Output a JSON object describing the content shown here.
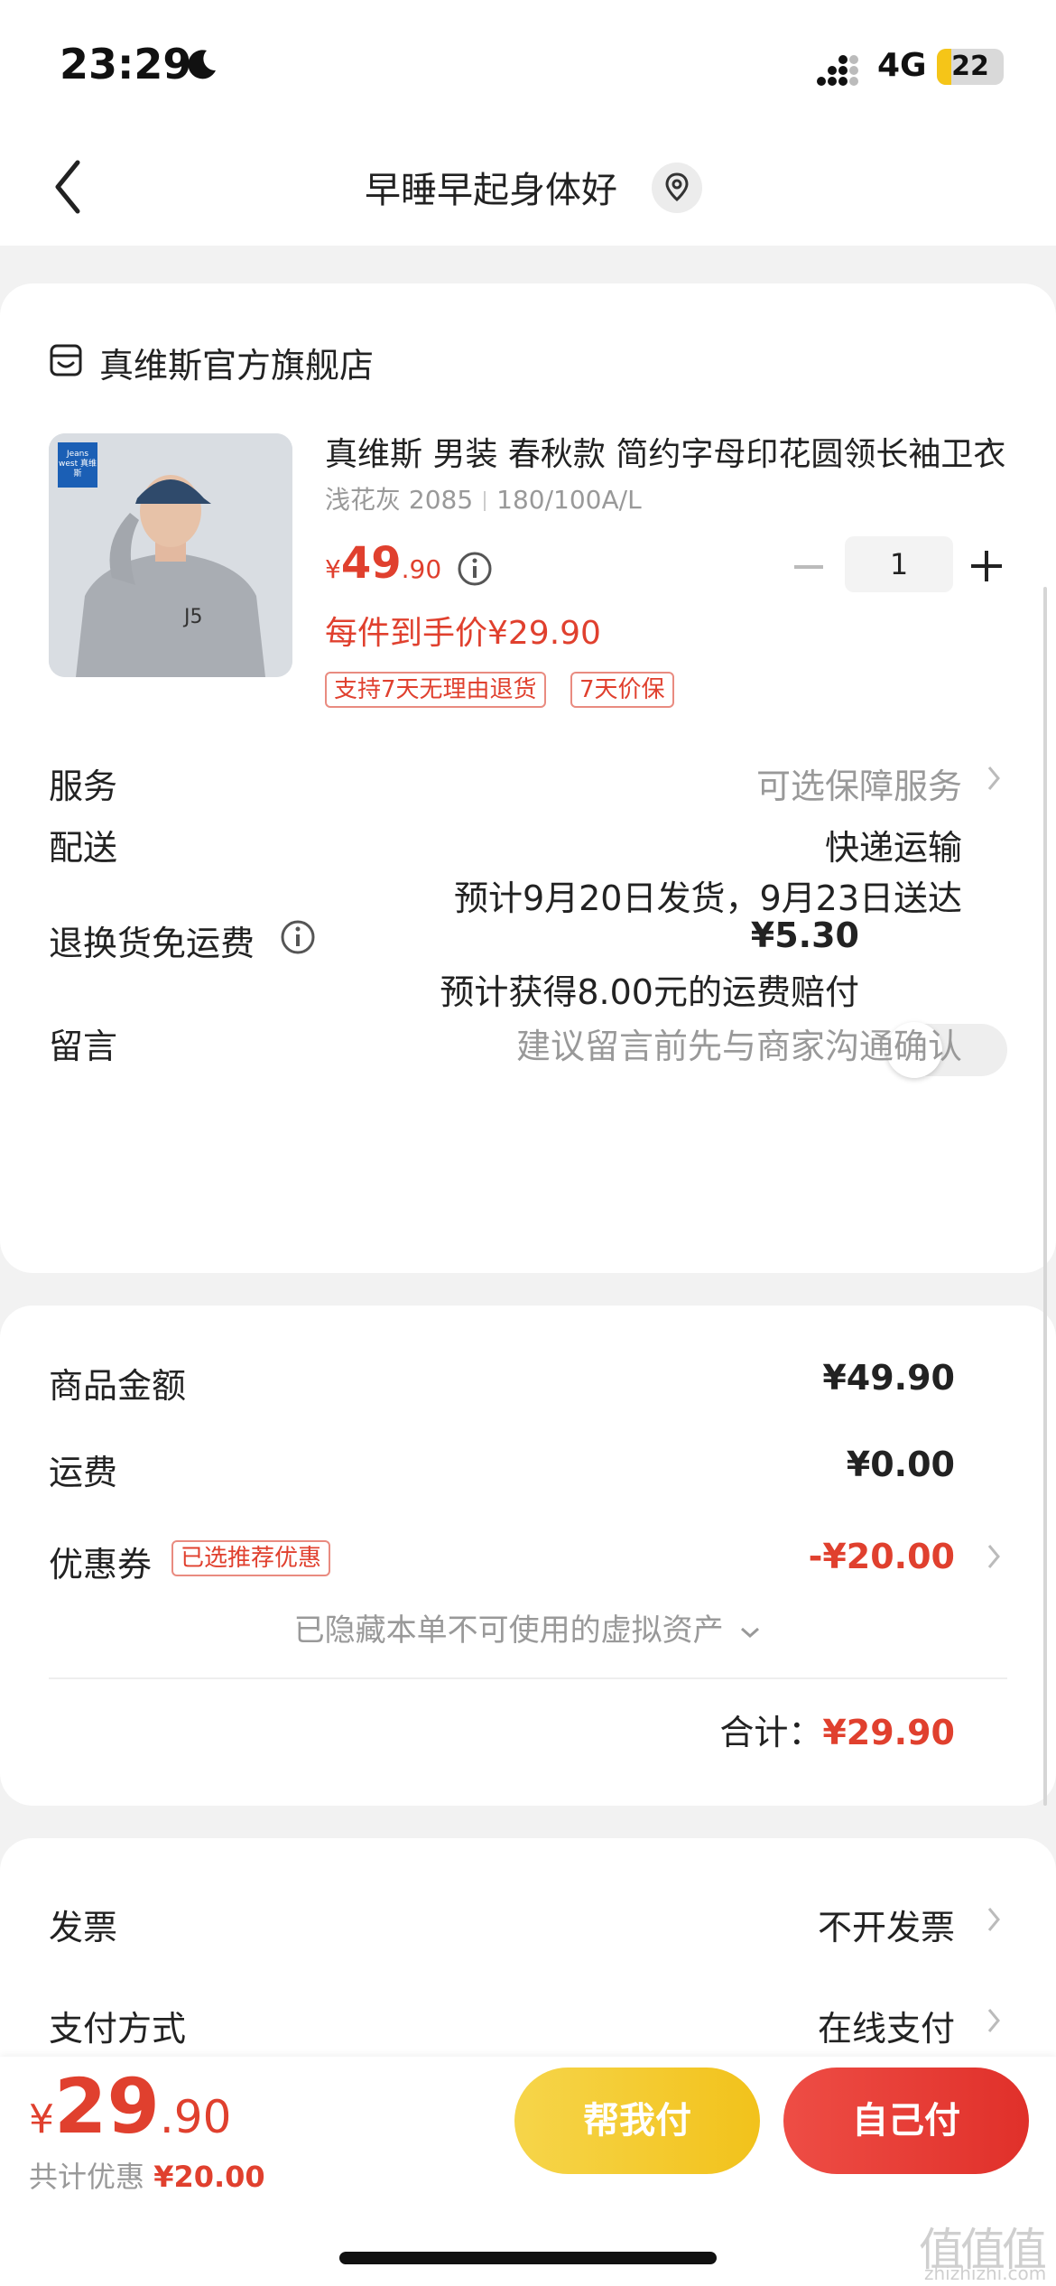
{
  "status_bar": {
    "time": "23:29",
    "network": "4G",
    "battery": "22",
    "battery_level": 0.22
  },
  "nav": {
    "title": "早睡早起身体好"
  },
  "order": {
    "shop_name": "真维斯官方旗舰店",
    "product": {
      "thumbnail_logo": "Jeans west 真维斯",
      "title": "真维斯 男装 春秋款 简约字母印花圆领长袖卫衣",
      "color": "浅花灰 2085",
      "size": "180/100A/L",
      "price_currency": "¥",
      "price_int": "49",
      "price_dec": ".90",
      "quantity": "1",
      "final_price": "每件到手价¥29.90",
      "tags": [
        "支持7天无理由退货",
        "7天价保"
      ]
    },
    "service": {
      "label": "服务",
      "value": "可选保障服务"
    },
    "delivery": {
      "label": "配送",
      "method": "快递运输",
      "eta": "预计9月20日发货，9月23日送达"
    },
    "return_shipping": {
      "label": "退换货免运费",
      "price": "¥5.30",
      "desc": "预计获得8.00元的运费赔付",
      "enabled": false
    },
    "message": {
      "label": "留言",
      "placeholder": "建议留言前先与商家沟通确认"
    }
  },
  "summary": {
    "goods_label": "商品金额",
    "goods_value": "¥49.90",
    "shipping_label": "运费",
    "shipping_value": "¥0.00",
    "coupon_label": "优惠券",
    "coupon_badge": "已选推荐优惠",
    "coupon_value": "-¥20.00",
    "hidden_assets": "已隐藏本单不可使用的虚拟资产",
    "total_label": "合计：",
    "total_value": "¥29.90"
  },
  "payment": {
    "invoice_label": "发票",
    "invoice_value": "不开发票",
    "method_label": "支付方式",
    "method_value": "在线支付"
  },
  "bottom_bar": {
    "currency": "¥",
    "price_int": "29",
    "price_dec": ".90",
    "saved_label": "共计优惠",
    "saved_value": "¥20.00",
    "help_pay": "帮我付",
    "self_pay": "自己付"
  },
  "watermark": {
    "glyphs": "值值值",
    "url": "zhizhizhi.com"
  },
  "colors": {
    "accent": "#e0402e",
    "help_button": "#f2c21b",
    "self_button": "#e0302a",
    "battery_fill": "#f5c518"
  }
}
